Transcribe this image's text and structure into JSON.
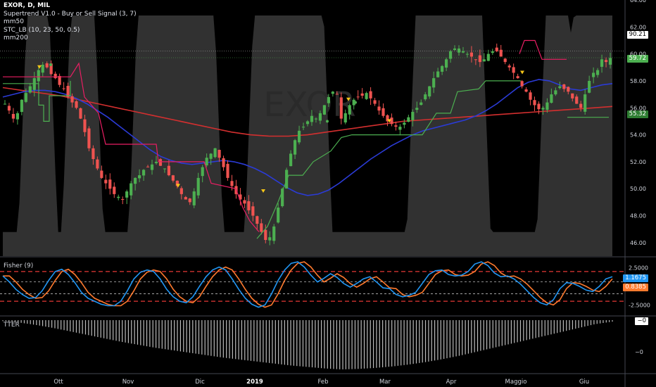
{
  "legend": {
    "title": "EXOR, D, MIL",
    "lines": [
      "Supertrend V1.0 - Buy or Sell Signal (3, 7)",
      "mm50",
      "STC_LB (10, 23, 50, 0.5)",
      "mm200"
    ]
  },
  "fisher_pane": {
    "label": "Fisher (9)"
  },
  "tter_pane": {
    "label": "TTER"
  },
  "watermark": "EXOR",
  "price_tags": {
    "last": "90.21",
    "close": "59.72",
    "supertrend": "55.32"
  },
  "fisher_tags": {
    "fisher": "1.1675",
    "trigger": "0.8385"
  },
  "tter_tags": {
    "top": "−0",
    "axis": "−0"
  },
  "colors": {
    "up": "#4caf50",
    "down": "#ef5350",
    "supertrend_up": "#4caf50",
    "supertrend_down": "#e91e63",
    "mm50": "#2b3bd6",
    "mm200": "#d32f2f",
    "stc": "#8c8c8c",
    "fisher": "#2196f3",
    "trigger": "#ff7a2e"
  },
  "chart_data": {
    "type": "candlestick",
    "ylim": [
      45,
      64
    ],
    "yticks": [
      "64.00",
      "62.00",
      "60.00",
      "58.00",
      "56.00",
      "54.00",
      "52.00",
      "50.00",
      "48.00",
      "46.00"
    ],
    "xticks": [
      "Ott",
      "Nov",
      "Dic",
      "2019",
      "Feb",
      "Mar",
      "Apr",
      "Maggio",
      "Giu"
    ],
    "close_series": [
      56.3,
      55.8,
      55.2,
      55.6,
      56.6,
      57.1,
      57.6,
      58.2,
      58.8,
      59.2,
      59.0,
      58.5,
      58.2,
      57.7,
      57.4,
      56.8,
      56.4,
      56.0,
      55.2,
      54.2,
      53.0,
      52.2,
      51.5,
      50.8,
      50.4,
      50.0,
      49.6,
      49.4,
      49.2,
      49.8,
      50.4,
      50.8,
      51.0,
      51.4,
      51.6,
      51.8,
      52.0,
      51.7,
      51.5,
      51.0,
      50.6,
      50.2,
      49.6,
      49.2,
      49.0,
      49.8,
      50.8,
      51.6,
      52.3,
      52.6,
      53.0,
      52.3,
      51.6,
      50.8,
      50.2,
      49.6,
      49.2,
      48.9,
      48.4,
      48.0,
      47.4,
      46.8,
      46.2,
      46.4,
      47.2,
      48.6,
      50.0,
      51.4,
      52.6,
      53.6,
      54.3,
      54.6,
      55.0,
      55.4,
      55.2,
      55.6,
      56.2,
      56.8,
      57.2,
      57.0,
      55.2,
      55.6,
      56.2,
      56.6,
      56.8,
      56.9,
      57.1,
      56.7,
      56.3,
      55.8,
      55.4,
      55.0,
      54.8,
      54.6,
      54.6,
      54.9,
      55.3,
      55.7,
      56.0,
      56.4,
      57.0,
      57.6,
      58.2,
      58.7,
      59.1,
      59.6,
      60.2,
      60.4,
      60.4,
      60.2,
      60.0,
      59.8,
      59.6,
      59.4,
      59.6,
      60.0,
      60.2,
      60.2,
      59.8,
      59.4,
      59.0,
      58.6,
      58.2,
      57.6,
      57.2,
      56.6,
      56.2,
      55.9,
      56.0,
      56.4,
      57.0,
      57.3,
      57.6,
      57.4,
      57.2,
      56.7,
      56.3,
      56.0,
      57.0,
      58.0,
      58.6,
      58.8,
      59.6,
      59.4,
      59.7
    ],
    "mm50": [
      56.8,
      57.0,
      57.2,
      57.3,
      57.3,
      57.2,
      57.0,
      56.7,
      56.3,
      55.8,
      55.3,
      54.7,
      54.1,
      53.5,
      52.9,
      52.4,
      52.1,
      51.9,
      51.8,
      51.9,
      52.0,
      52.1,
      52.0,
      51.8,
      51.5,
      51.1,
      50.6,
      50.1,
      49.7,
      49.5,
      49.6,
      49.9,
      50.4,
      51.0,
      51.6,
      52.2,
      52.7,
      53.2,
      53.6,
      54.0,
      54.3,
      54.5,
      54.7,
      54.9,
      55.1,
      55.4,
      55.8,
      56.3,
      56.9,
      57.5,
      57.9,
      58.1,
      58.0,
      57.7,
      57.4,
      57.3,
      57.5,
      57.7,
      57.8
    ],
    "mm200": [
      57.5,
      57.3,
      57.1,
      56.9,
      56.6,
      56.3,
      56.0,
      55.7,
      55.4,
      55.1,
      54.8,
      54.5,
      54.2,
      54.0,
      53.9,
      53.9,
      54.0,
      54.2,
      54.4,
      54.6,
      54.8,
      55.0,
      55.1,
      55.2,
      55.3,
      55.4,
      55.5,
      55.6,
      55.7,
      55.8,
      55.9,
      56.0,
      56.1
    ],
    "fisher": [
      1.4,
      0.6,
      -0.4,
      -1.1,
      -1.6,
      -1.5,
      -0.6,
      0.8,
      2.0,
      2.3,
      1.6,
      0.5,
      -0.8,
      -1.6,
      -2.0,
      -2.4,
      -2.6,
      -2.6,
      -2.0,
      -0.6,
      1.0,
      1.9,
      2.2,
      2.0,
      1.0,
      -0.4,
      -1.4,
      -2.0,
      -2.2,
      -1.4,
      0.0,
      1.3,
      2.2,
      2.6,
      2.2,
      1.0,
      -0.4,
      -1.6,
      -2.4,
      -2.8,
      -2.5,
      -1.0,
      0.8,
      2.2,
      3.1,
      3.3,
      2.6,
      1.5,
      0.6,
      1.1,
      1.7,
      1.2,
      0.4,
      -0.1,
      0.4,
      1.0,
      1.3,
      0.6,
      -0.2,
      -0.3,
      -1.1,
      -1.4,
      -1.2,
      -0.8,
      0.4,
      1.6,
      2.1,
      2.2,
      1.6,
      1.4,
      1.5,
      2.0,
      3.0,
      3.3,
      2.8,
      1.8,
      1.3,
      1.4,
      1.0,
      0.3,
      -0.6,
      -1.5,
      -2.2,
      -2.5,
      -1.8,
      -0.3,
      0.5,
      0.4,
      0.0,
      -0.5,
      -0.7,
      0.0,
      1.0,
      1.3
    ],
    "tter_depth": [
      0.02,
      0.05,
      0.1,
      0.16,
      0.23,
      0.3,
      0.37,
      0.44,
      0.5,
      0.56,
      0.61,
      0.66,
      0.71,
      0.76,
      0.8,
      0.84,
      0.88,
      0.92,
      0.95,
      0.98,
      1.0,
      0.99,
      0.97,
      0.94,
      0.9,
      0.85,
      0.79,
      0.72,
      0.64,
      0.56,
      0.48,
      0.4,
      0.32,
      0.24,
      0.16,
      0.08,
      0.03
    ]
  }
}
